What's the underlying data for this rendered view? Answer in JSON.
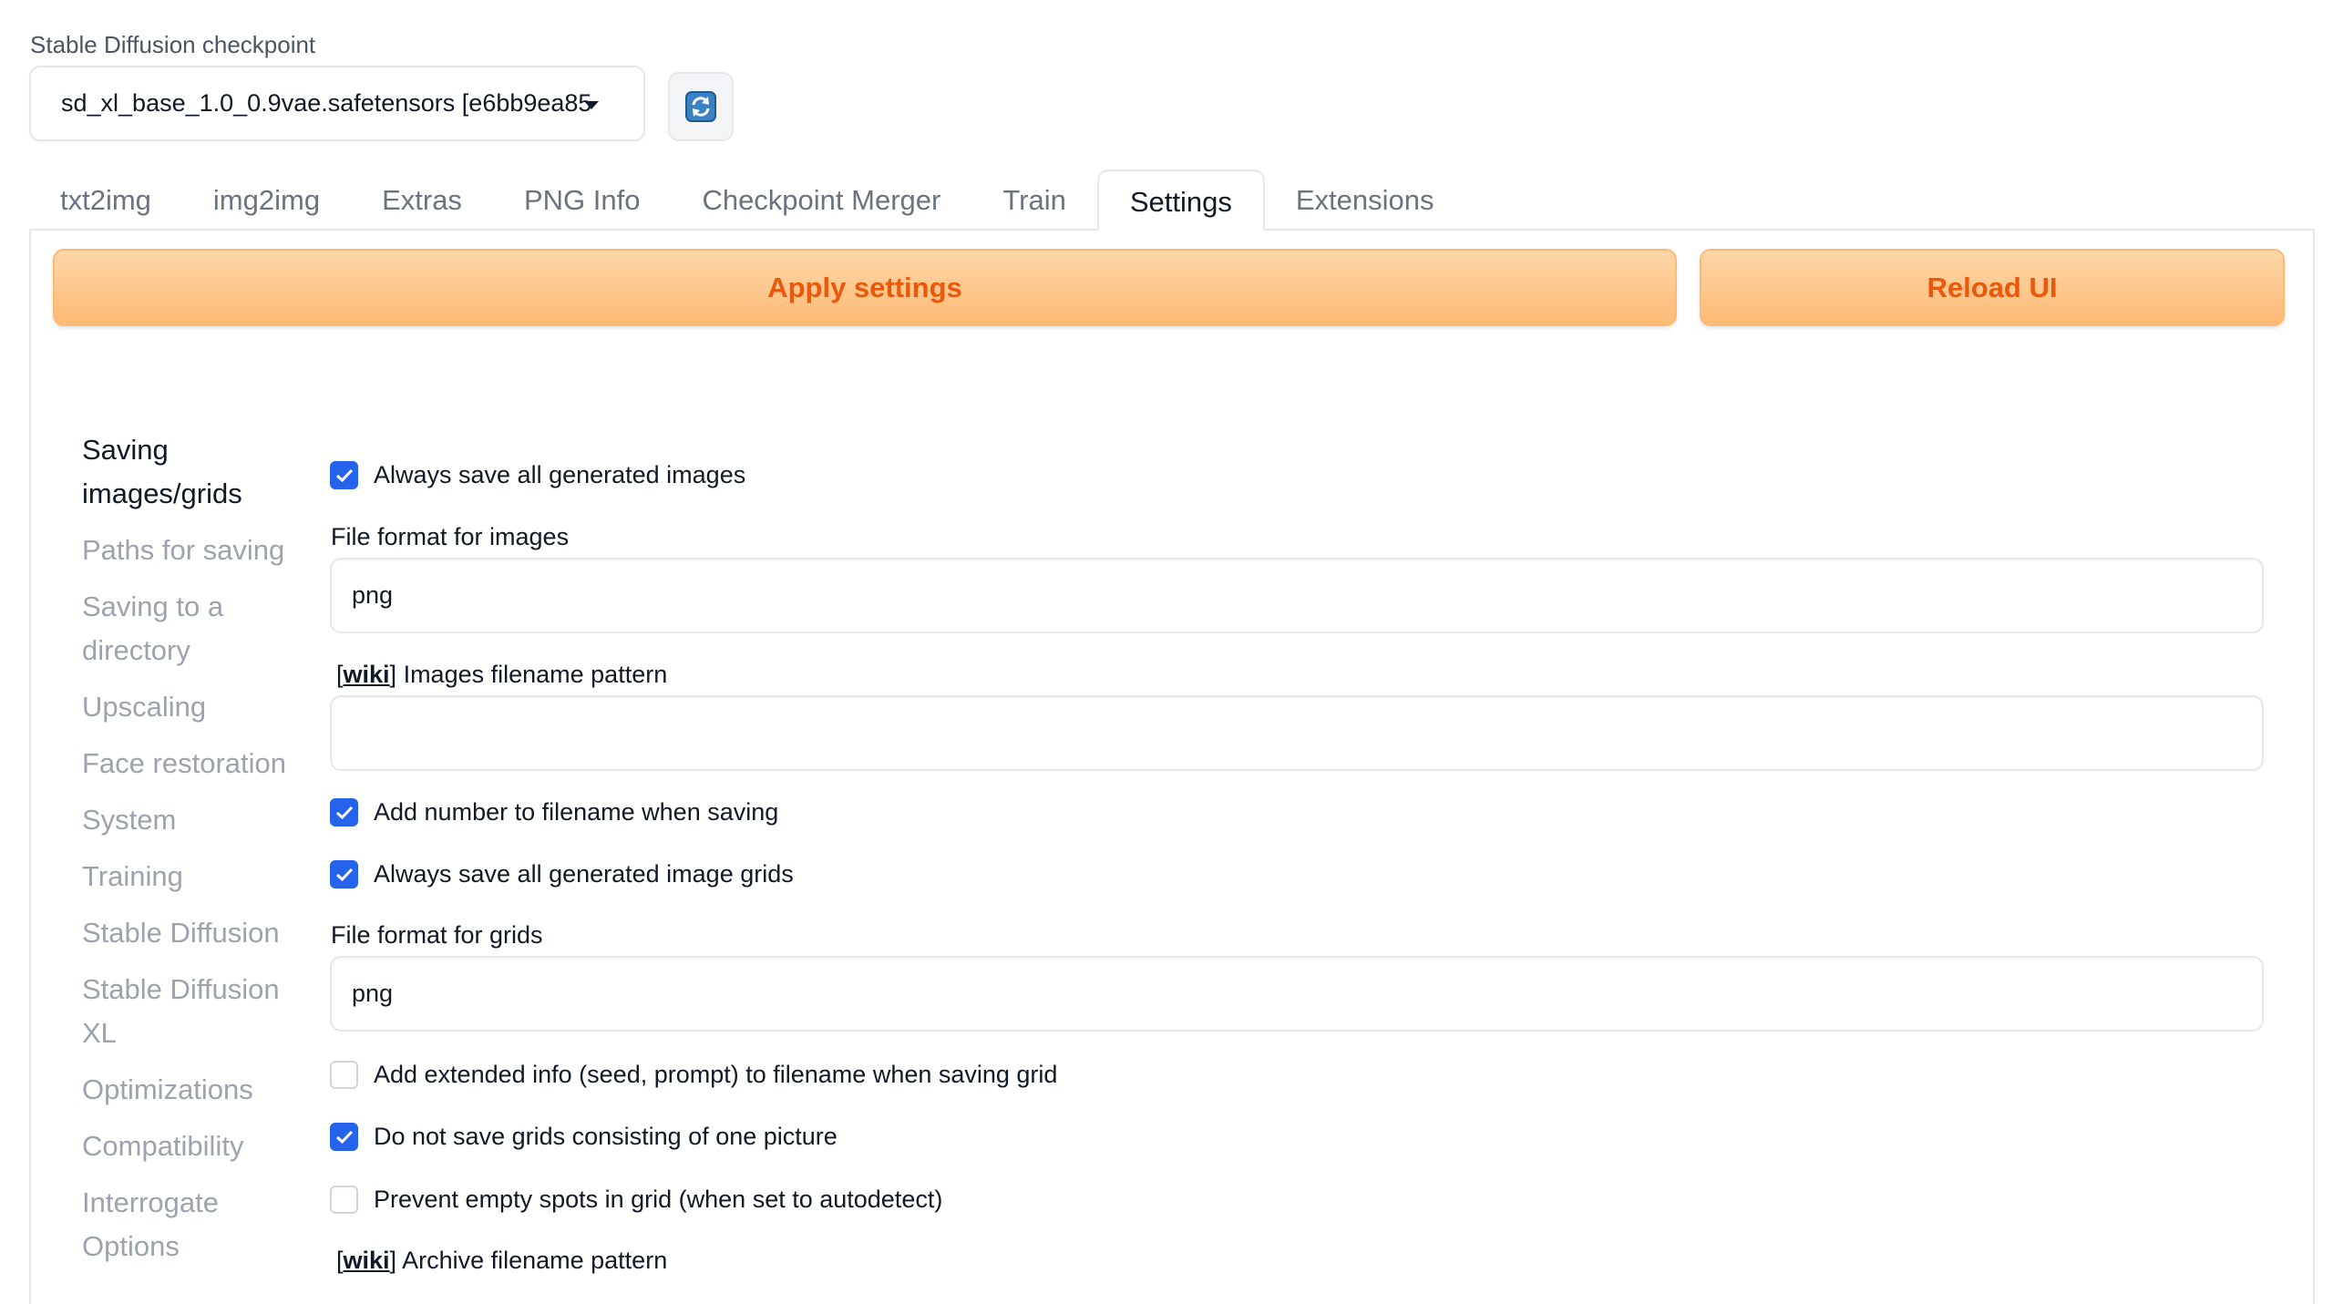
{
  "checkpoint": {
    "label": "Stable Diffusion checkpoint",
    "value": "sd_xl_base_1.0_0.9vae.safetensors [e6bb9ea85",
    "refresh_icon": "refresh-icon"
  },
  "tabs": [
    {
      "label": "txt2img"
    },
    {
      "label": "img2img"
    },
    {
      "label": "Extras"
    },
    {
      "label": "PNG Info"
    },
    {
      "label": "Checkpoint Merger"
    },
    {
      "label": "Train"
    },
    {
      "label": "Settings",
      "active": true
    },
    {
      "label": "Extensions"
    }
  ],
  "actions": {
    "apply_label": "Apply settings",
    "reload_label": "Reload UI"
  },
  "sidebar": {
    "items": [
      {
        "label": "Saving images/grids",
        "active": true
      },
      {
        "label": "Paths for saving"
      },
      {
        "label": "Saving to a directory"
      },
      {
        "label": "Upscaling"
      },
      {
        "label": "Face restoration"
      },
      {
        "label": "System"
      },
      {
        "label": "Training"
      },
      {
        "label": "Stable Diffusion"
      },
      {
        "label": "Stable Diffusion XL"
      },
      {
        "label": "Optimizations"
      },
      {
        "label": "Compatibility"
      },
      {
        "label": "Interrogate Options"
      }
    ]
  },
  "settings": {
    "save_images": {
      "label": "Always save all generated images",
      "checked": true
    },
    "file_format_images": {
      "label": "File format for images",
      "value": "png"
    },
    "images_filename_pattern": {
      "wiki": "wiki",
      "label": "Images filename pattern",
      "value": ""
    },
    "add_number": {
      "label": "Add number to filename when saving",
      "checked": true
    },
    "save_grids": {
      "label": "Always save all generated image grids",
      "checked": true
    },
    "file_format_grids": {
      "label": "File format for grids",
      "value": "png"
    },
    "grid_extended_filename": {
      "label": "Add extended info (seed, prompt) to filename when saving grid",
      "checked": false
    },
    "grid_only_if_multiple": {
      "label": "Do not save grids consisting of one picture",
      "checked": true
    },
    "grid_prevent_empty_spots": {
      "label": "Prevent empty spots in grid (when set to autodetect)",
      "checked": false
    },
    "archive_filename_pattern": {
      "wiki": "wiki",
      "label": "Archive filename pattern"
    }
  },
  "colors": {
    "accent_orange": "#ea580c",
    "checkbox_blue": "#2563eb"
  }
}
